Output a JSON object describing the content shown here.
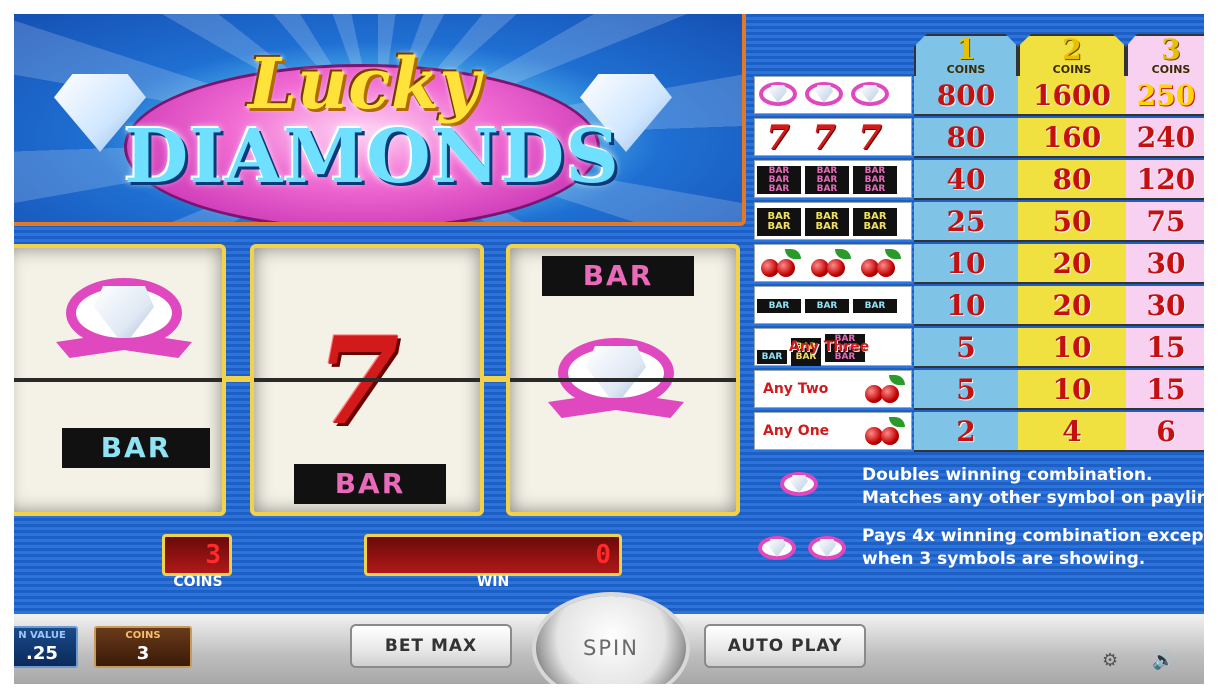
{
  "logo": {
    "lucky": "Lucky",
    "diamonds": "DIAMONDS"
  },
  "reels": {
    "reel1": {
      "bottom_symbol": "BAR"
    },
    "reel2": {
      "center_symbol": "7",
      "bottom_symbol": "BAR"
    },
    "reel3": {
      "top_symbol": "BAR"
    }
  },
  "displays": {
    "coins_value": "3",
    "coins_label": "COINS",
    "win_value": "0",
    "win_label": "WIN"
  },
  "paytable": {
    "headers": [
      {
        "num": "1",
        "label": "COINS"
      },
      {
        "num": "2",
        "label": "COINS"
      },
      {
        "num": "3",
        "label": "COINS"
      }
    ],
    "rows": [
      {
        "symbol": "wild-x3",
        "payouts": [
          "800",
          "1600",
          "250"
        ]
      },
      {
        "symbol": "seven-x3",
        "seven": "7",
        "payouts": [
          "80",
          "160",
          "240"
        ]
      },
      {
        "symbol": "triple-bar-x3",
        "bar_text": "BAR",
        "payouts": [
          "40",
          "80",
          "120"
        ]
      },
      {
        "symbol": "double-bar-x3",
        "bar_text": "BAR",
        "payouts": [
          "25",
          "50",
          "75"
        ]
      },
      {
        "symbol": "cherry-x3",
        "payouts": [
          "10",
          "20",
          "30"
        ]
      },
      {
        "symbol": "single-bar-x3",
        "bar_text": "BAR",
        "payouts": [
          "10",
          "20",
          "30"
        ]
      },
      {
        "symbol": "any-three-bar",
        "text": "Any Three",
        "bar_text": "BAR",
        "payouts": [
          "5",
          "10",
          "15"
        ]
      },
      {
        "symbol": "any-two-cherry",
        "text": "Any Two",
        "payouts": [
          "5",
          "10",
          "15"
        ]
      },
      {
        "symbol": "any-one-cherry",
        "text": "Any One",
        "payouts": [
          "2",
          "4",
          "6"
        ]
      }
    ]
  },
  "info": {
    "line1": "Doubles winning combination.",
    "line2": "Matches any other symbol on paylin",
    "line3": "Pays 4x winning combination excep",
    "line4": "when 3 symbols are showing."
  },
  "controls": {
    "coin_value_label": "N VALUE",
    "coin_value": ".25",
    "coins_label": "COINS",
    "coins_value": "3",
    "bet_max": "BET MAX",
    "spin": "SPIN",
    "auto_play": "AUTO PLAY",
    "settings_icon": "gear-icon",
    "sound_icon": "speaker-icon"
  },
  "colors": {
    "background_blue": "#1d5fc4",
    "gold_border": "#f2d24a",
    "payout_red": "#c41010",
    "col1": "#7fc4e6",
    "col2": "#f0e040",
    "col3": "#f8d0f0"
  }
}
